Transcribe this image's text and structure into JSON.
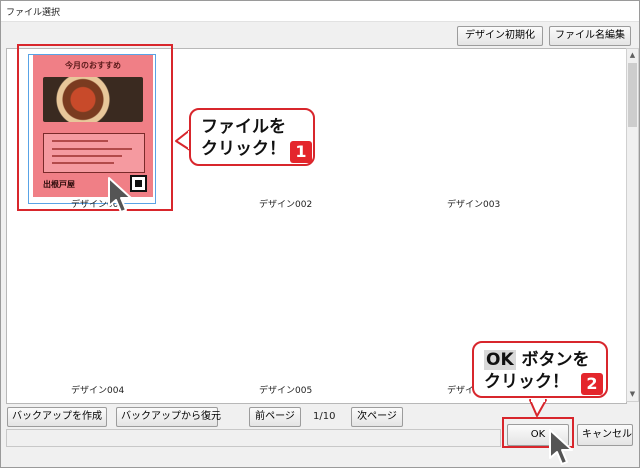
{
  "window": {
    "title": "ファイル選択"
  },
  "toolbar": {
    "reset_design": "デザイン初期化",
    "edit_filename": "ファイル名編集"
  },
  "designs": [
    {
      "label": "デザイン001"
    },
    {
      "label": "デザイン002"
    },
    {
      "label": "デザイン003"
    },
    {
      "label": "デザイン004"
    },
    {
      "label": "デザイン005"
    },
    {
      "label": "デザイン"
    }
  ],
  "poster": {
    "title": "今月のおすすめ",
    "shop_name": "出根戸屋"
  },
  "bottom": {
    "create_backup": "バックアップを作成",
    "restore_backup": "バックアップから復元",
    "prev_page": "前ページ",
    "page_indicator": "1/10",
    "next_page": "次ページ",
    "ok": "OK",
    "cancel": "キャンセル"
  },
  "annotations": {
    "callout1_line1": "ファイルを",
    "callout1_line2": "クリック！",
    "callout1_badge": "1",
    "callout2_line1_ok": "OK",
    "callout2_line1_rest": " ボタンを",
    "callout2_line2": "クリック！",
    "callout2_badge": "2",
    "accent_color": "#d8262c"
  }
}
